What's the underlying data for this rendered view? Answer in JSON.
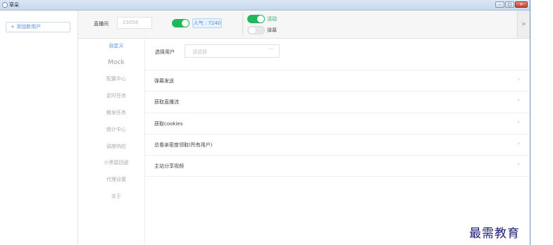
{
  "window": {
    "title": "草朵",
    "min": "–",
    "max": "□",
    "close": "✕"
  },
  "left_panel": {
    "add_user": "+ 添加新用户"
  },
  "toolbar": {
    "room_label": "直播间",
    "room_id": "23056",
    "popularity": "人气 : 7240",
    "activity_label": "活动",
    "danmu_label": "弹幕",
    "collapse": "»"
  },
  "side_menu": {
    "items": [
      "自定义",
      "Mock",
      "配置中心",
      "定时任务",
      "触发任务",
      "统计中心",
      "调度响应",
      "小黑屋回避",
      "代理设置",
      "关于"
    ],
    "active_index": 0
  },
  "content": {
    "select_label": "选择用户",
    "select_placeholder": "请选择",
    "rows": [
      "弹幕发送",
      "获取直播流",
      "获取cookies",
      "总看亲密度领取(所有用户)",
      "主站分享视频"
    ]
  },
  "toggles": {
    "main_on": true,
    "activity_on": true,
    "danmu_on": false
  },
  "colors": {
    "accent_blue": "#4d8ee0",
    "toggle_green": "#1fb85d",
    "watermark": "#1b1b78"
  },
  "watermark": "最需教育"
}
